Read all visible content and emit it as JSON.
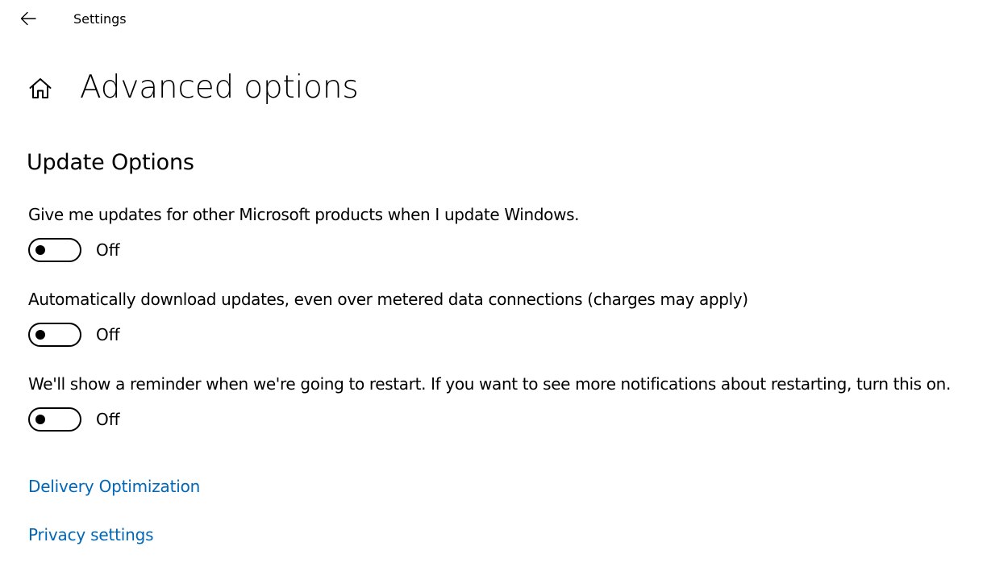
{
  "window": {
    "title": "Settings",
    "back_icon": "back-arrow-icon"
  },
  "header": {
    "home_icon": "home-icon",
    "title": "Advanced options"
  },
  "section": {
    "title": "Update Options"
  },
  "options": [
    {
      "label": "Give me updates for other Microsoft products when I update Windows.",
      "state": "Off",
      "enabled": false
    },
    {
      "label": "Automatically download updates, even over metered data connections (charges may apply)",
      "state": "Off",
      "enabled": false
    },
    {
      "label": "We'll show a reminder when we're going to restart. If you want to see more notifications about restarting, turn this on.",
      "state": "Off",
      "enabled": false
    }
  ],
  "links": {
    "delivery_optimization": "Delivery Optimization",
    "privacy_settings": "Privacy settings"
  },
  "colors": {
    "link": "#0067b8",
    "text": "#000000",
    "background": "#ffffff"
  }
}
